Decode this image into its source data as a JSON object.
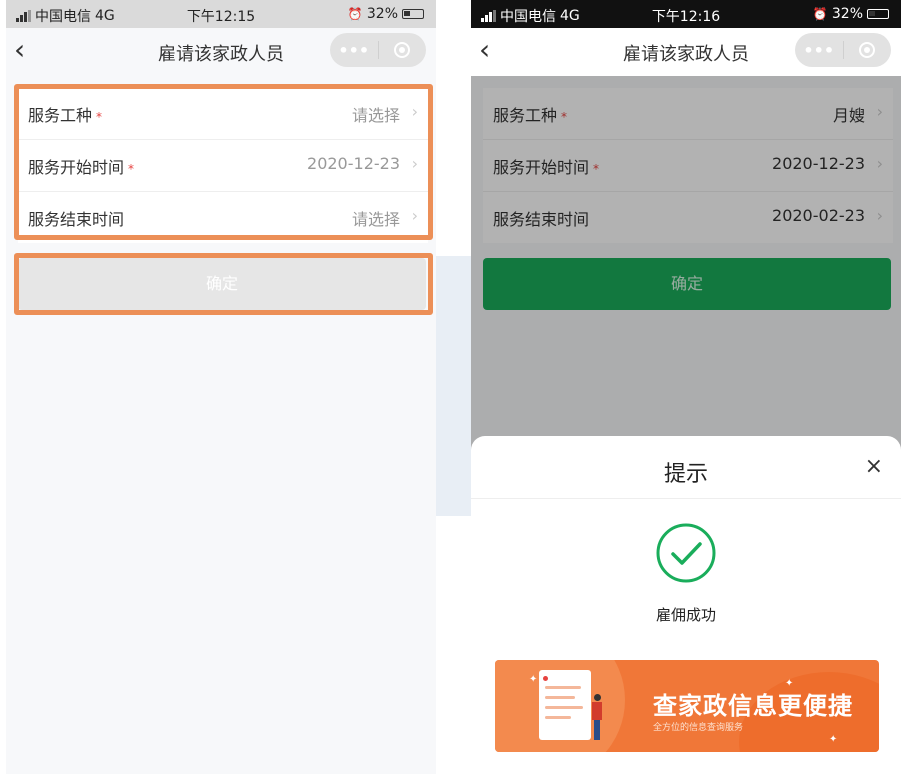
{
  "left_screen": {
    "status": {
      "carrier": "中国电信",
      "network": "4G",
      "time": "下午12:15",
      "battery": "32%"
    },
    "nav": {
      "title": "雇请该家政人员"
    },
    "form": {
      "rows": [
        {
          "label": "服务工种",
          "value": "请选择",
          "required": "*"
        },
        {
          "label": "服务开始时间",
          "value": "2020-12-23",
          "required": "*"
        },
        {
          "label": "服务结束时间",
          "value": "请选择",
          "required": ""
        }
      ]
    },
    "confirm_label": "确定"
  },
  "right_screen": {
    "status": {
      "carrier": "中国电信",
      "network": "4G",
      "time": "下午12:16",
      "battery": "32%"
    },
    "nav": {
      "title": "雇请该家政人员"
    },
    "form": {
      "rows": [
        {
          "label": "服务工种",
          "value": "月嫂",
          "required": "*"
        },
        {
          "label": "服务开始时间",
          "value": "2020-12-23",
          "required": "*"
        },
        {
          "label": "服务结束时间",
          "value": "2020-02-23",
          "required": ""
        }
      ]
    },
    "confirm_label": "确定",
    "dialog": {
      "title": "提示",
      "close": "×",
      "success_text": "雇佣成功",
      "banner_title": "查家政信息更便捷",
      "banner_subtitle": "全方位的信息查询服务"
    }
  },
  "colors": {
    "highlight": "#ec8f57",
    "accent_green": "#1aad5b",
    "banner_orange": "#f07738",
    "required_red": "#e64340"
  }
}
